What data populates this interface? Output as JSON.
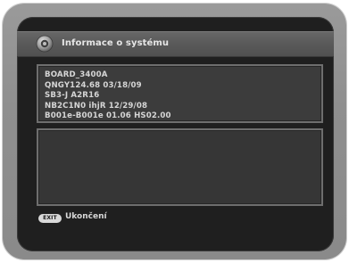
{
  "window": {
    "title": "Informace o systému",
    "icon": "settings-disc-icon"
  },
  "info": {
    "lines": [
      "BOARD_3400A",
      "QNGY124.68 03/18/09",
      "SB3-J A2R16",
      "NB2C1N0 ihjR 12/29/08",
      "B001e-B001e 01.06  HS02.00"
    ]
  },
  "footer": {
    "key_label": "EXIT",
    "action_label": "Ukončení"
  },
  "colors": {
    "bezel": "#8f8f8f",
    "screen_background": "#1f1f1f",
    "panel_background": "#3c3c3c",
    "text": "#d6d6d6"
  }
}
